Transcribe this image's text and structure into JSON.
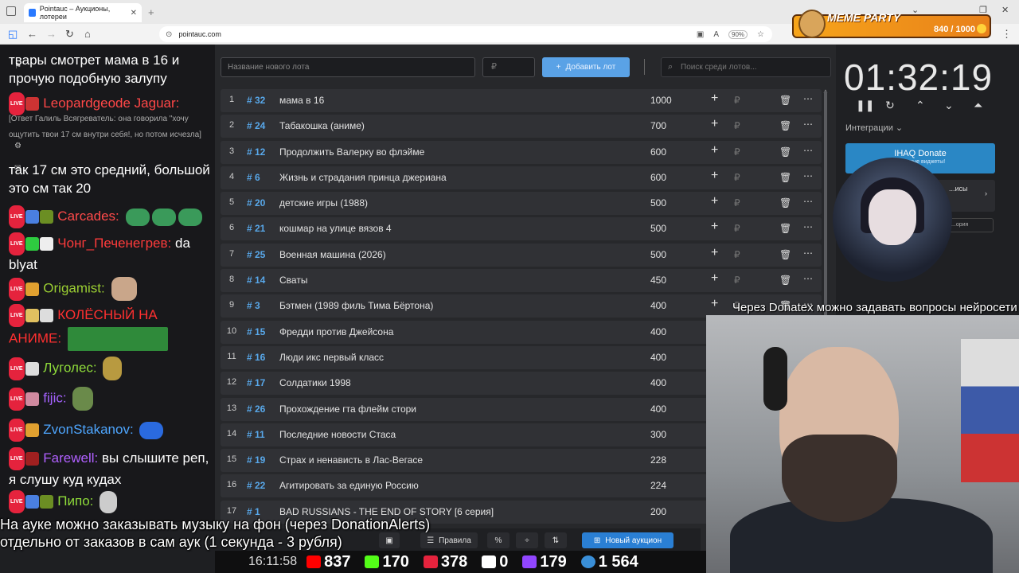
{
  "browser": {
    "tab_title": "Pointauc – Аукционы, лотереи",
    "url": "pointauc.com",
    "zoom": "90%"
  },
  "overlay": {
    "meme_party_title": "MEME PARTY",
    "meme_party_count": "840 / 1000"
  },
  "chat": {
    "messages": [
      {
        "user": "",
        "text": "твары смотрет мама в 16 и прочую подобную залупу",
        "color": "#ffffff"
      },
      {
        "user": "Leopardgeode Jaguar:",
        "text": "",
        "color": "#ff4747"
      },
      {
        "reply": "[Ответ Галиль Всягреватель: она говорила \"хочу ощутить твои 17 см внутри себя!, но потом исчезла]"
      },
      {
        "user": "",
        "text": "так 17 см это средний, большой это см так 20"
      },
      {
        "user": "Carcades:",
        "text": "",
        "color": "#ff4a4a"
      },
      {
        "user": "Чонг_Печенегрев:",
        "text": "da blyat",
        "color": "#ff3b3b"
      },
      {
        "user": "Origamist:",
        "text": "",
        "color": "#9acd32"
      },
      {
        "user": "КОЛЁСНЫЙ НА АНИМЕ:",
        "text": "",
        "color": "#ff3030"
      },
      {
        "user": "Луголес:",
        "text": "",
        "color": "#8fdc3a"
      },
      {
        "user": "fijic:",
        "text": "",
        "color": "#a562ff"
      },
      {
        "user": "ZvonStakanov:",
        "text": "",
        "color": "#4ea6ff"
      },
      {
        "user": "Farewell:",
        "text": "вы слышите реп, я слушу куд кудах",
        "color": "#b060ff"
      },
      {
        "user": "Пипо:",
        "text": "",
        "color": "#8fdc3a"
      }
    ]
  },
  "auction": {
    "new_lot_placeholder": "Название нового лота",
    "amount_placeholder": "₽",
    "add_lot_label": "Добавить лот",
    "search_placeholder": "Поиск среди лотов...",
    "lots": [
      {
        "n": "1",
        "id": "# 32",
        "name": "мама в 16",
        "amount": "1000"
      },
      {
        "n": "2",
        "id": "# 24",
        "name": "Табакошка (аниме)",
        "amount": "700"
      },
      {
        "n": "3",
        "id": "# 12",
        "name": "Продолжить Валерку во флэйме",
        "amount": "600"
      },
      {
        "n": "4",
        "id": "# 6",
        "name": "Жизнь и страдания принца джериана",
        "amount": "600"
      },
      {
        "n": "5",
        "id": "# 20",
        "name": "детские игры (1988)",
        "amount": "500"
      },
      {
        "n": "6",
        "id": "# 21",
        "name": "кошмар на улице вязов 4",
        "amount": "500"
      },
      {
        "n": "7",
        "id": "# 25",
        "name": "Военная машина (2026)",
        "amount": "500"
      },
      {
        "n": "8",
        "id": "# 14",
        "name": "Сваты",
        "amount": "450"
      },
      {
        "n": "9",
        "id": "# 3",
        "name": "Бэтмен (1989 филь Тима Бёртона)",
        "amount": "400"
      },
      {
        "n": "10",
        "id": "# 15",
        "name": "Фредди против Джейсона",
        "amount": "400"
      },
      {
        "n": "11",
        "id": "# 16",
        "name": "Люди икс первый класс",
        "amount": "400"
      },
      {
        "n": "12",
        "id": "# 17",
        "name": "Солдатики 1998",
        "amount": "400"
      },
      {
        "n": "13",
        "id": "# 26",
        "name": "Прохождение гта флейм стори",
        "amount": "400"
      },
      {
        "n": "14",
        "id": "# 11",
        "name": "Последние новости Стаса",
        "amount": "300"
      },
      {
        "n": "15",
        "id": "# 19",
        "name": "Страх и ненависть в Лас-Вегасе",
        "amount": "228"
      },
      {
        "n": "16",
        "id": "# 22",
        "name": "Агитировать за единую Россию",
        "amount": "224"
      },
      {
        "n": "17",
        "id": "# 1",
        "name": "BAD RUSSIANS - THE END OF STORY [6 серия]",
        "amount": "200"
      }
    ],
    "bottom": {
      "rules_label": "Правила",
      "new_auction_label": "Новый аукцион"
    }
  },
  "timer": {
    "value": "01:32:19",
    "integrations_label": "Интеграции",
    "donate_title": "IHAQ Donate",
    "donate_sub": "...альные виджеты!",
    "card2_text": "...исы",
    "card3_text": "...ория"
  },
  "notice": "Через Donatex можно задавать вопросы нейросети",
  "caption": {
    "line1": "На ауке можно заказывать музыку на фон (через DonationAlerts)",
    "line2": "отдельно от заказов в сам аук (1 секунда - 3 рубля)"
  },
  "stats": {
    "time": "16:11:58",
    "youtube": "837",
    "kick": "170",
    "live": "378",
    "r": "0",
    "x": "179",
    "people": "1 564"
  }
}
